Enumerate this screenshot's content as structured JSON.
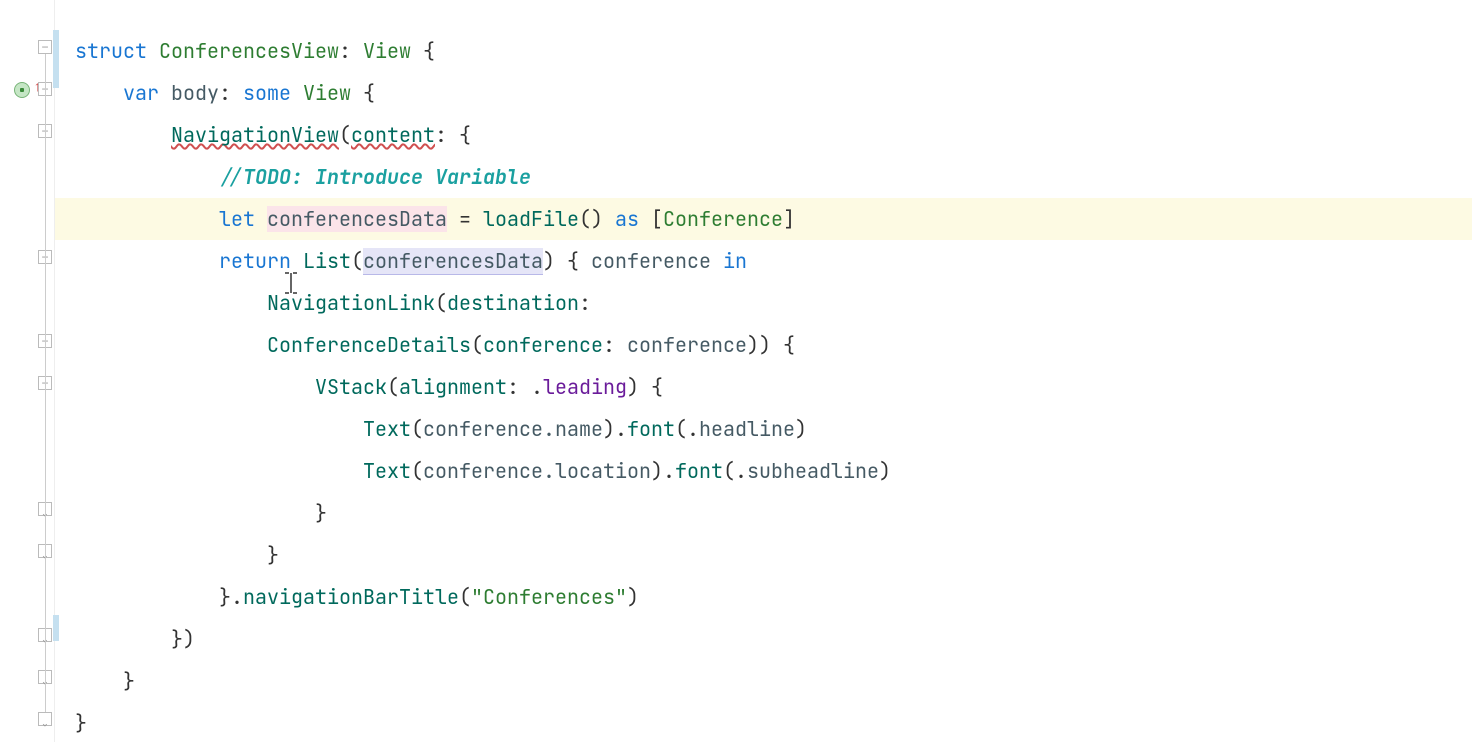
{
  "code": {
    "l1": {
      "kw_struct": "struct",
      "name": "ConferencesView",
      "colon": ":",
      "type": "View",
      "brace": "{"
    },
    "l2": {
      "kw_var": "var",
      "name": "body",
      "colon": ":",
      "kw_some": "some",
      "type": "View",
      "brace": "{"
    },
    "l3": {
      "call": "NavigationView",
      "open": "(",
      "param": "content",
      "colon": ":",
      "brace": "{"
    },
    "l4": {
      "comment_slashes": "//",
      "comment_todo": "TODO: Introduce Variable"
    },
    "l5": {
      "kw_let": "let",
      "var": "conferencesData",
      "eq": "=",
      "fn": "loadFile",
      "parens": "()",
      "kw_as": "as",
      "lbr": "[",
      "type": "Conference",
      "rbr": "]"
    },
    "l6": {
      "kw_return": "return",
      "call": "List",
      "open": "(",
      "arg": "conferencesData",
      "close": ")",
      "brace": "{",
      "id": "conference",
      "kw_in": "in"
    },
    "l7": {
      "call": "NavigationLink",
      "open": "(",
      "param": "destination",
      "colon": ":"
    },
    "l8": {
      "call": "ConferenceDetails",
      "open": "(",
      "param": "conference",
      "colon": ":",
      "arg": "conference",
      "close": "))",
      "brace": "{"
    },
    "l9": {
      "call": "VStack",
      "open": "(",
      "param": "alignment",
      "colon": ":",
      "dot": ".",
      "val": "leading",
      "close": ")",
      "brace": "{"
    },
    "l10": {
      "fn": "Text",
      "open": "(",
      "arg": "conference.name",
      "close": ")",
      "dot": ".",
      "fn2": "font",
      "open2": "(",
      "dot2": ".",
      "val": "headline",
      "close2": ")"
    },
    "l11": {
      "fn": "Text",
      "open": "(",
      "arg": "conference.location",
      "close": ")",
      "dot": ".",
      "fn2": "font",
      "open2": "(",
      "dot2": ".",
      "val": "subheadline",
      "close2": ")"
    },
    "l12": {
      "brace": "}"
    },
    "l13": {
      "brace": "}"
    },
    "l14": {
      "brace": "}",
      "dot": ".",
      "fn": "navigationBarTitle",
      "open": "(",
      "str": "\"Conferences\"",
      "close": ")"
    },
    "l15": {
      "text": "})"
    },
    "l16": {
      "brace": "}"
    },
    "l17": {
      "brace": "}"
    }
  }
}
